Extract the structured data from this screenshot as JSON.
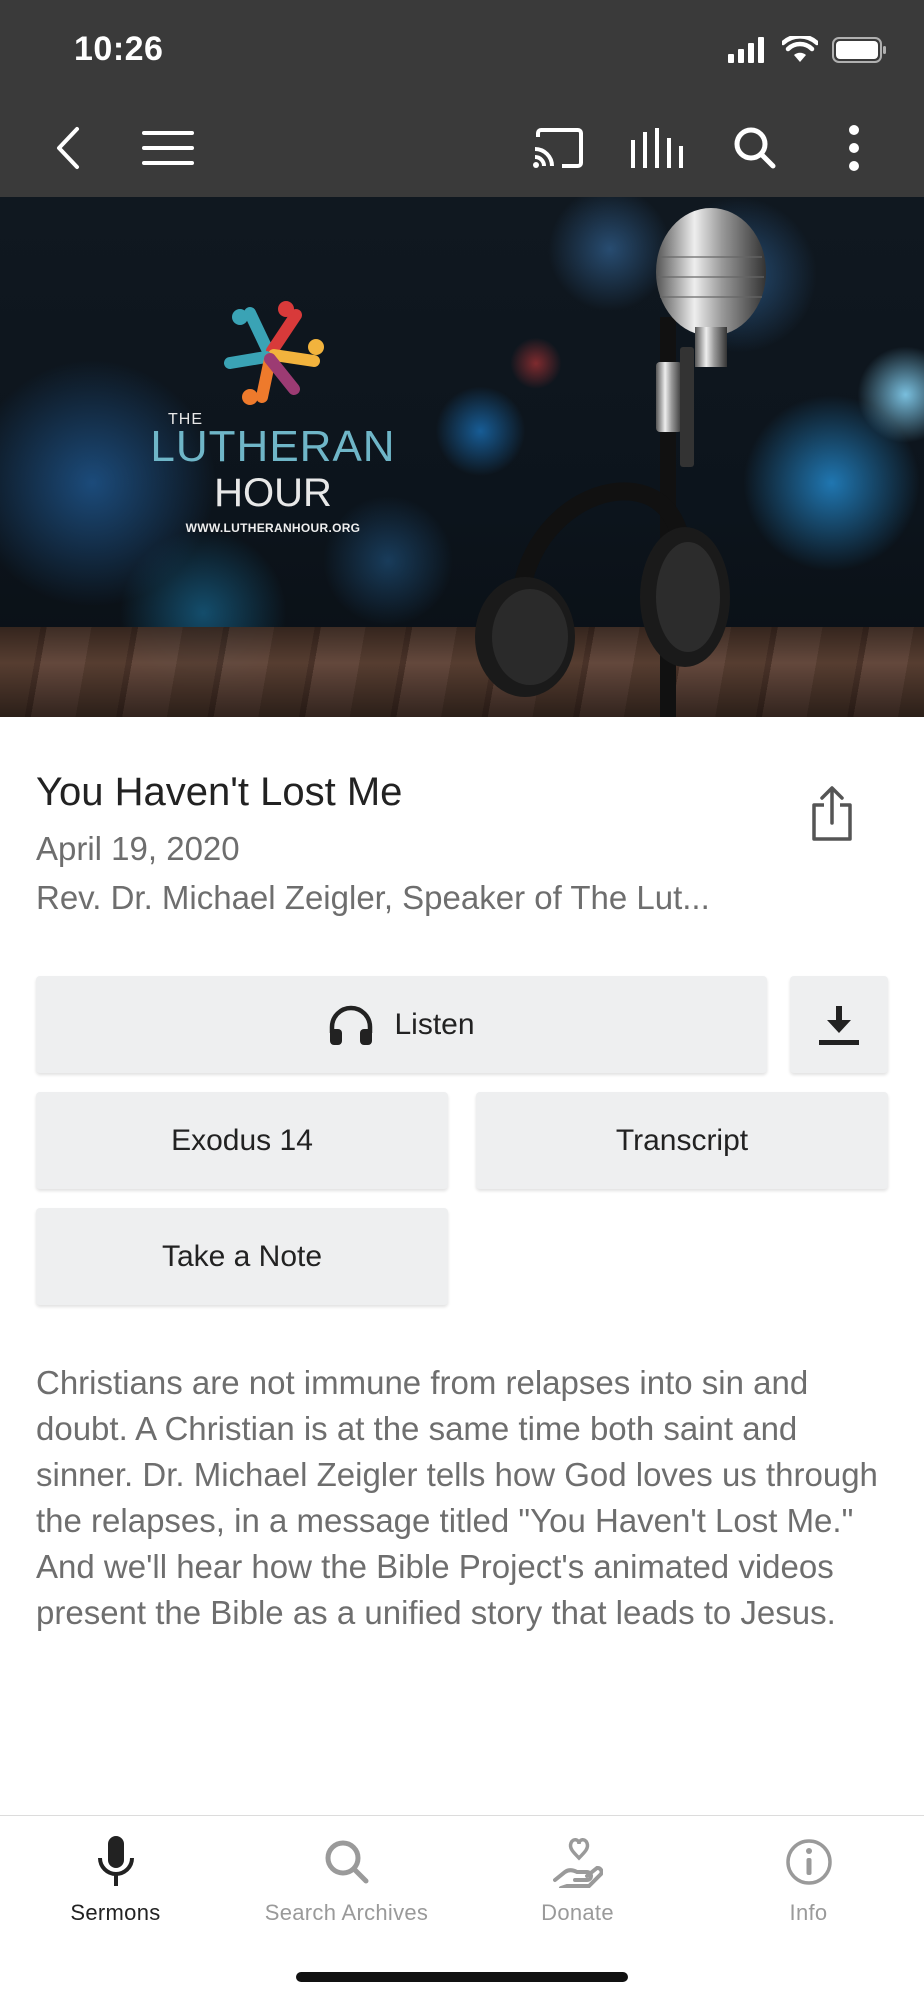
{
  "status_bar": {
    "time": "10:26"
  },
  "hero": {
    "logo_the": "THE",
    "logo_lutheran": "LUTHERAN",
    "logo_hour": "HOUR",
    "logo_url": "WWW.LUTHERANHOUR.ORG"
  },
  "sermon": {
    "title": "You Haven't Lost Me",
    "date": "April 19, 2020",
    "speaker": "Rev. Dr. Michael Zeigler, Speaker of The Lut...",
    "description": "Christians are not immune from relapses into sin and doubt. A Christian is at the same time both saint and sinner. Dr. Michael Zeigler tells how God loves us through the relapses, in a message titled \"You Haven't Lost Me.\" And we'll hear how the Bible Project's animated videos present the Bible as a unified story that leads to Jesus."
  },
  "actions": {
    "listen": "Listen",
    "scripture": "Exodus 14",
    "transcript": "Transcript",
    "note": "Take a Note"
  },
  "tabs": [
    {
      "label": "Sermons",
      "icon": "microphone-icon",
      "active": true
    },
    {
      "label": "Search Archives",
      "icon": "search-icon",
      "active": false
    },
    {
      "label": "Donate",
      "icon": "donate-hand-heart-icon",
      "active": false
    },
    {
      "label": "Info",
      "icon": "info-icon",
      "active": false
    }
  ],
  "colors": {
    "bar_background": "#3a3a3a",
    "button_background": "#eeeff0",
    "logo_accent": "#6fb6c8"
  }
}
